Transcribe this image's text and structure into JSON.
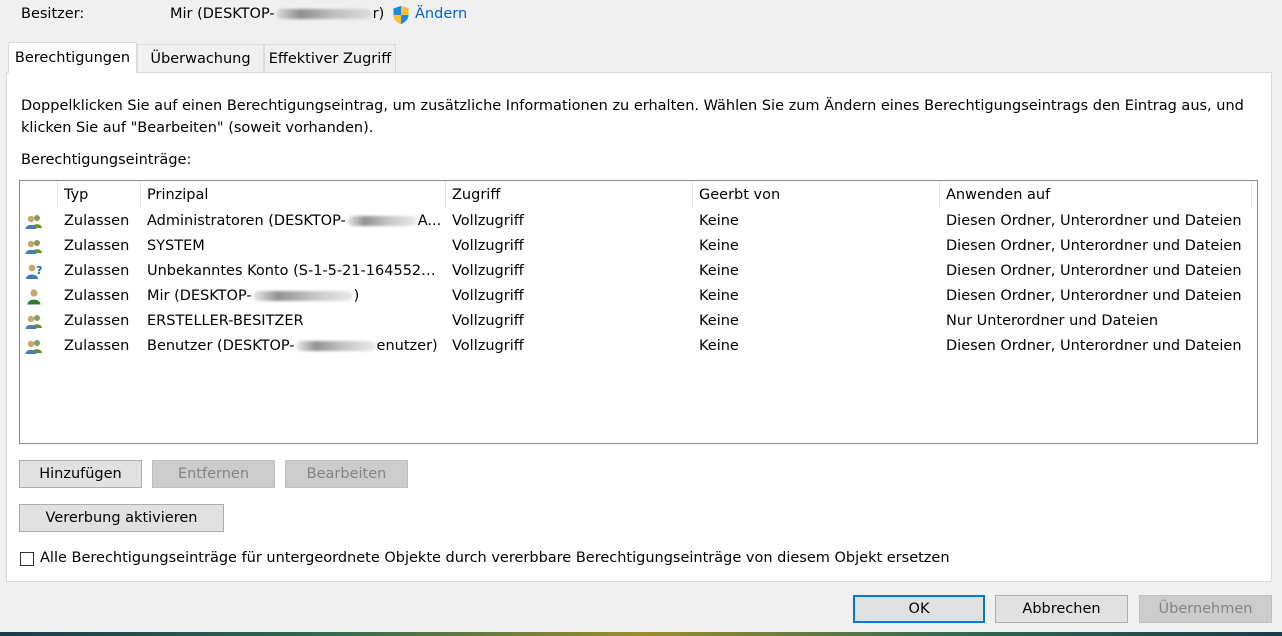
{
  "owner": {
    "label": "Besitzer:",
    "value_prefix": "Mir (DESKTOP-",
    "value_suffix": "r)",
    "change_link": "Ändern"
  },
  "tabs": [
    {
      "label": "Berechtigungen",
      "active": true
    },
    {
      "label": "Überwachung",
      "active": false
    },
    {
      "label": "Effektiver Zugriff",
      "active": false
    }
  ],
  "description": "Doppelklicken Sie auf einen Berechtigungseintrag, um zusätzliche Informationen zu erhalten. Wählen Sie zum Ändern eines Berechtigungseintrags den Eintrag aus, und klicken Sie auf \"Bearbeiten\" (soweit vorhanden).",
  "entries_label": "Berechtigungseinträge:",
  "columns": [
    "Typ",
    "Prinzipal",
    "Zugriff",
    "Geerbt von",
    "Anwenden auf"
  ],
  "rows": [
    {
      "icon": "group",
      "type": "Zulassen",
      "principal_prefix": "Administratoren (DESKTOP-",
      "principal_suffix": "A...",
      "access": "Vollzugriff",
      "inherited": "Keine",
      "applies": "Diesen Ordner, Unterordner und Dateien"
    },
    {
      "icon": "group",
      "type": "Zulassen",
      "principal_prefix": "SYSTEM",
      "principal_suffix": "",
      "access": "Vollzugriff",
      "inherited": "Keine",
      "applies": "Diesen Ordner, Unterordner und Dateien"
    },
    {
      "icon": "unknown",
      "type": "Zulassen",
      "principal_prefix": "Unbekanntes Konto (S-1-5-21-1645522...",
      "principal_suffix": "",
      "access": "Vollzugriff",
      "inherited": "Keine",
      "applies": "Diesen Ordner, Unterordner und Dateien"
    },
    {
      "icon": "user",
      "type": "Zulassen",
      "principal_prefix": "Mir (DESKTOP-",
      "principal_suffix": ")",
      "access": "Vollzugriff",
      "inherited": "Keine",
      "applies": "Diesen Ordner, Unterordner und Dateien"
    },
    {
      "icon": "group",
      "type": "Zulassen",
      "principal_prefix": "ERSTELLER-BESITZER",
      "principal_suffix": "",
      "access": "Vollzugriff",
      "inherited": "Keine",
      "applies": "Nur Unterordner und Dateien"
    },
    {
      "icon": "group",
      "type": "Zulassen",
      "principal_prefix": "Benutzer (DESKTOP-",
      "principal_suffix": "enutzer)",
      "access": "Vollzugriff",
      "inherited": "Keine",
      "applies": "Diesen Ordner, Unterordner und Dateien"
    }
  ],
  "buttons": {
    "add": "Hinzufügen",
    "remove": "Entfernen",
    "edit": "Bearbeiten",
    "enable_inheritance": "Vererbung aktivieren"
  },
  "replace_checkbox": {
    "label": "Alle Berechtigungseinträge für untergeordnete Objekte durch vererbbare Berechtigungseinträge von diesem Objekt ersetzen",
    "checked": false
  },
  "dialog_buttons": {
    "ok": "OK",
    "cancel": "Abbrechen",
    "apply": "Übernehmen"
  },
  "colors": {
    "link": "#0066cc",
    "default_button_border": "#0078d7",
    "disabled_text": "#838383"
  }
}
